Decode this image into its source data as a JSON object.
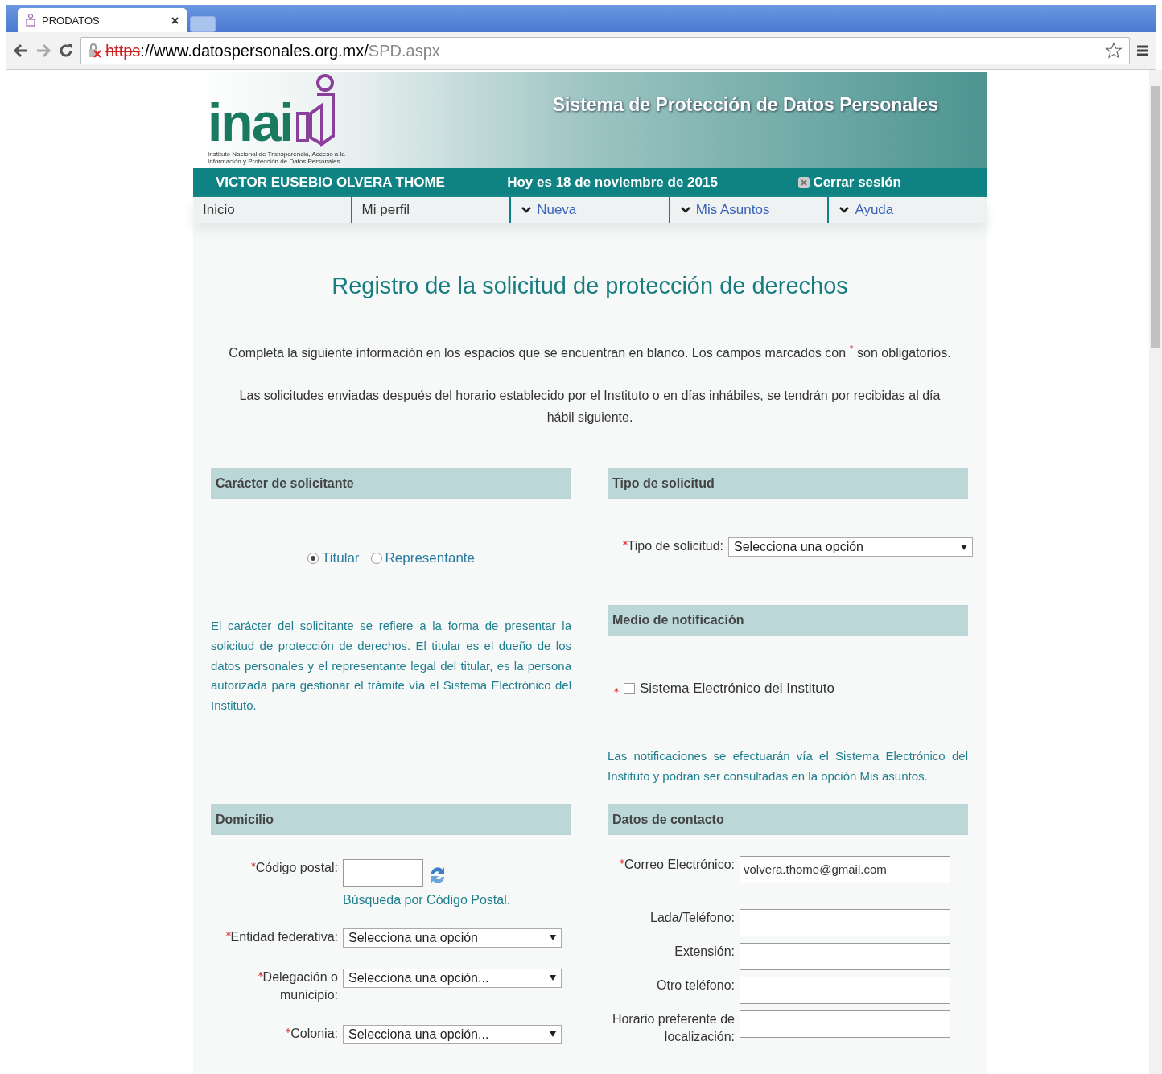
{
  "browser": {
    "tab_title": "PRODATOS",
    "url_scheme": "https",
    "url_host": "://www.datospersonales.org.mx/",
    "url_path": "SPD.aspx"
  },
  "header": {
    "logo_text": "inai",
    "logo_caption": "Instituto Nacional de Transparencia, Acceso a la Información y Protección de Datos Personales",
    "system_title": "Sistema de Protección de Datos Personales"
  },
  "user_bar": {
    "user": "VICTOR EUSEBIO OLVERA THOME",
    "date": "Hoy es 18 de noviembre de 2015",
    "logout": "Cerrar sesión"
  },
  "nav": [
    {
      "label": "Inicio",
      "dropdown": false
    },
    {
      "label": "Mi perfil",
      "dropdown": false
    },
    {
      "label": "Nueva",
      "dropdown": true
    },
    {
      "label": "Mis Asuntos",
      "dropdown": true
    },
    {
      "label": "Ayuda",
      "dropdown": true
    }
  ],
  "page": {
    "title": "Registro de la solicitud de protección de derechos",
    "intro": [
      "Completa la siguiente información en los espacios que se encuentran en blanco. Los campos marcados con $^{*}$ son obligatorios.",
      "Las solicitudes enviadas después del horario establecido por el Instituto o en días inhábiles, se tendrán por recibidas al día hábil siguiente."
    ]
  },
  "caracter": {
    "header": "Carácter de solicitante",
    "options": [
      {
        "label": "Titular",
        "selected": true
      },
      {
        "label": "Representante",
        "selected": false
      }
    ],
    "description": "El carácter del solicitante se refiere a la forma de presentar la solicitud de protección de derechos. El titular es el dueño de los datos personales y el representante legal del titular, es la persona autorizada para gestionar el trámite vía el Sistema Electrónico del Instituto."
  },
  "tipo": {
    "header": "Tipo de solicitud",
    "field": {
      "kind": "select",
      "label": "Tipo de solicitud:",
      "required": true,
      "value": "Selecciona una opción"
    }
  },
  "medio": {
    "header": "Medio de notificación",
    "option": {
      "label": "Sistema Electrónico del Instituto",
      "required": true,
      "checked": false
    },
    "note": "Las notificaciones se efectuarán vía el Sistema Electrónico del Instituto y podrán ser consultadas en la opción Mis asuntos."
  },
  "domicilio": {
    "header": "Domicilio",
    "fields": [
      {
        "kind": "postal",
        "label": "Código postal:",
        "required": true,
        "link": "Búsqueda por Código Postal."
      },
      {
        "kind": "select",
        "label": "Entidad federativa:",
        "required": true,
        "value": "Selecciona una opción"
      },
      {
        "kind": "select",
        "label": "Delegación o municipio:",
        "required": true,
        "value": "Selecciona una opción..."
      },
      {
        "kind": "select",
        "label": "Colonia:",
        "required": true,
        "value": "Selecciona una opción..."
      }
    ]
  },
  "contacto": {
    "header": "Datos de contacto",
    "fields": [
      {
        "kind": "input",
        "label": "Correo Electrónico:",
        "required": true,
        "value": "volvera.thome@gmail.com"
      },
      {
        "kind": "input",
        "label": "Lada/Teléfono:",
        "required": false
      },
      {
        "kind": "input",
        "label": "Extensión:",
        "required": false
      },
      {
        "kind": "input",
        "label": "Otro teléfono:",
        "required": false
      },
      {
        "kind": "input",
        "label": "Horario preferente de localización:",
        "required": false
      }
    ]
  }
}
